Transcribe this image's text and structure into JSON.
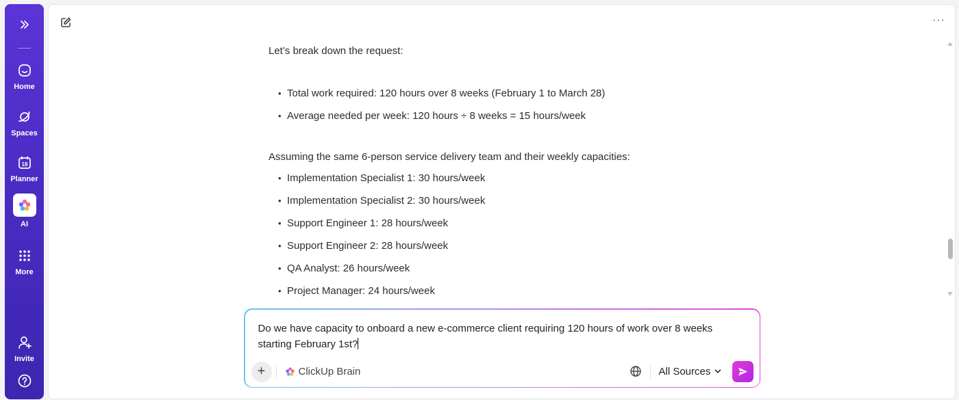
{
  "sidebar": {
    "expand_icon": "double-chevron-right-icon",
    "items": [
      {
        "label": "Home",
        "icon": "home-icon"
      },
      {
        "label": "Spaces",
        "icon": "planet-icon"
      },
      {
        "label": "Planner",
        "icon": "calendar-icon",
        "icon_text": "18"
      },
      {
        "label": "AI",
        "icon": "ai-brain-icon"
      },
      {
        "label": "More",
        "icon": "grid-icon"
      },
      {
        "label": "Invite",
        "icon": "add-user-icon"
      }
    ],
    "help_icon": "help-icon"
  },
  "header": {
    "new_chat_icon": "edit-icon",
    "more_icon": "more-horizontal-icon",
    "more_text": "···"
  },
  "message": {
    "intro": "Let’s break down the request:",
    "summary_bullets": [
      "Total work required: 120 hours over 8 weeks (February 1 to March 28)",
      "Average needed per week: 120 hours ÷ 8 weeks = 15 hours/week"
    ],
    "team_intro": "Assuming the same 6-person service delivery team and their weekly capacities:",
    "team_bullets": [
      "Implementation Specialist 1: 30 hours/week",
      "Implementation Specialist 2: 30 hours/week",
      "Support Engineer 1: 28 hours/week",
      "Support Engineer 2: 28 hours/week",
      "QA Analyst: 26 hours/week",
      "Project Manager: 24 hours/week"
    ],
    "bullet_char": "•"
  },
  "composer": {
    "input_value": "Do we have capacity to onboard a new e-commerce client requiring 120 hours of work over 8 weeks starting February 1st?",
    "plus_label": "+",
    "brain_label": "ClickUp Brain",
    "sources_label": "All Sources",
    "accent_gradient": [
      "#6ec6e8",
      "#b48af0",
      "#e24ad8"
    ],
    "send_color": "#d633dc"
  },
  "colors": {
    "sidebar": "#4a2cc4",
    "text": "#2d2d32"
  }
}
